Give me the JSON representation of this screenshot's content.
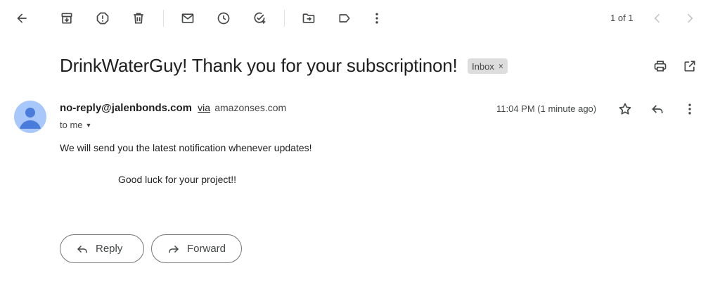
{
  "toolbar": {
    "back": "arrow-left-icon",
    "archive": "archive-icon",
    "spam": "report-spam-icon",
    "delete": "trash-icon",
    "mark_unread": "mail-icon",
    "snooze": "clock-icon",
    "add_task": "add-task-icon",
    "move": "move-to-folder-icon",
    "label": "label-icon",
    "more": "more-vertical-icon"
  },
  "pagination": {
    "count_text": "1 of 1"
  },
  "email": {
    "subject": "DrinkWaterGuy! Thank you for your subscriptinon!",
    "label_chip": "Inbox",
    "label_remove": "×",
    "sender": "no-reply@jalenbonds.com",
    "via": "via",
    "via_domain": "amazonses.com",
    "recipient": "to me",
    "timestamp": "11:04 PM (1 minute ago)",
    "body_line1": "We will send you the latest notification whenever updates!",
    "body_line2": "Good luck for your project!!"
  },
  "actions": {
    "reply_label": "Reply",
    "forward_label": "Forward"
  },
  "colors": {
    "avatar_bg": "#a8c7fa",
    "avatar_fg": "#4a7cdc",
    "chip_bg": "#dddddd",
    "icon": "#444746"
  }
}
